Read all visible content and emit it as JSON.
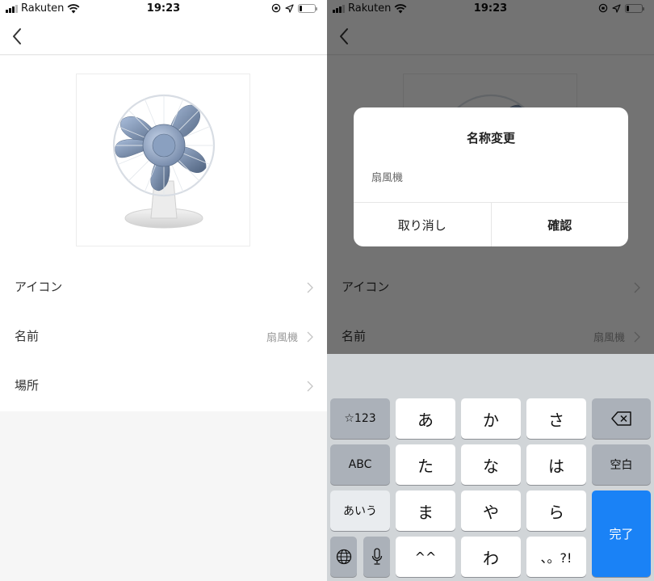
{
  "status_bar": {
    "carrier": "Rakuten",
    "time": "19:23",
    "battery_level_percent": 15,
    "icons": [
      "signal-icon",
      "wifi-icon",
      "orientation-lock-icon",
      "location-icon",
      "battery-icon"
    ]
  },
  "nav": {
    "back_icon": "chevron-left-icon"
  },
  "device": {
    "icon_image": "electric-fan-icon"
  },
  "settings_list": [
    {
      "label": "アイコン",
      "value": "",
      "chevron": "chevron-right-icon"
    },
    {
      "label": "名前",
      "value": "扇風機",
      "chevron": "chevron-right-icon"
    },
    {
      "label": "場所",
      "value": "",
      "chevron": "chevron-right-icon"
    }
  ],
  "rename_dialog": {
    "title": "名称変更",
    "input_value": "扇風機",
    "cancel_label": "取り消し",
    "confirm_label": "確認"
  },
  "keyboard": {
    "rows": [
      [
        "☆123",
        "あ",
        "か",
        "さ",
        "delete"
      ],
      [
        "ABC",
        "た",
        "な",
        "は",
        "空白"
      ],
      [
        "あいう",
        "ま",
        "や",
        "ら",
        "完了"
      ],
      [
        "globe",
        "mic",
        "^^",
        "わ",
        "、。?!"
      ]
    ],
    "keys": {
      "symbols": "☆123",
      "a": "あ",
      "ka": "か",
      "sa": "さ",
      "abc": "ABC",
      "ta": "た",
      "na": "な",
      "ha": "は",
      "space": "空白",
      "kana": "あいう",
      "ma": "ま",
      "ya": "や",
      "ra": "ら",
      "done": "完了",
      "kaomoji": "^^",
      "wa": "わ",
      "punct": "、。?!"
    },
    "accent_color": "#1a82f6"
  }
}
